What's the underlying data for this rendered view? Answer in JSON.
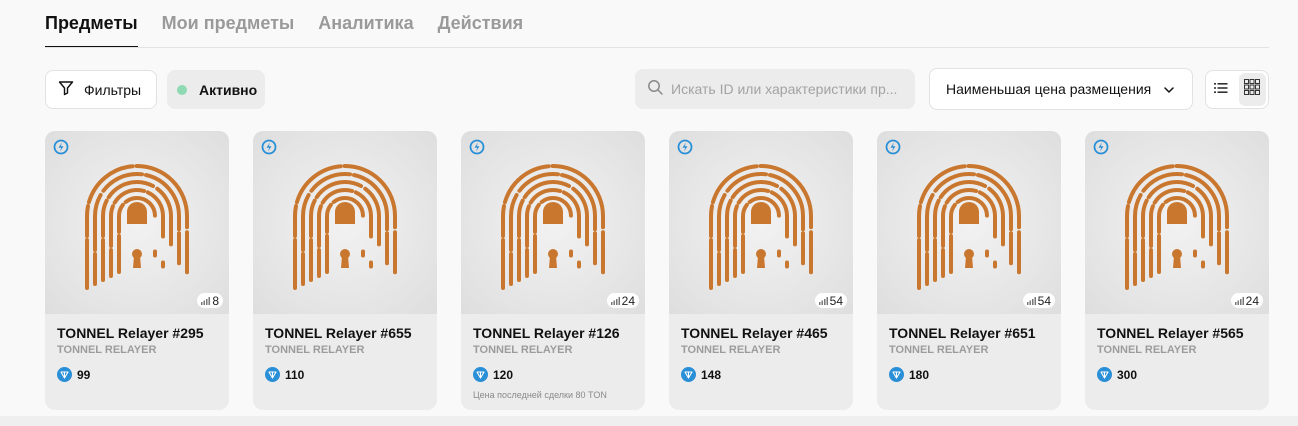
{
  "tabs": [
    {
      "label": "Предметы",
      "active": true
    },
    {
      "label": "Мои предметы",
      "active": false
    },
    {
      "label": "Аналитика",
      "active": false
    },
    {
      "label": "Действия",
      "active": false
    }
  ],
  "toolbar": {
    "filters_label": "Фильтры",
    "active_label": "Активно",
    "search_placeholder": "Искать ID или характеристики пр...",
    "sort_label": "Наименьшая цена размещения"
  },
  "colors": {
    "accent_dot": "#8fd9b3",
    "ton_blue": "#2a8fd6",
    "artwork": "#c9772f"
  },
  "cards": [
    {
      "name": "TONNEL Relayer #295",
      "collection": "TONNEL RELAYER",
      "price": "99",
      "count": "8",
      "last_sale": ""
    },
    {
      "name": "TONNEL Relayer #655",
      "collection": "TONNEL RELAYER",
      "price": "110",
      "count": "",
      "last_sale": ""
    },
    {
      "name": "TONNEL Relayer #126",
      "collection": "TONNEL RELAYER",
      "price": "120",
      "count": "24",
      "last_sale": "Цена последней сделки 80 TON"
    },
    {
      "name": "TONNEL Relayer #465",
      "collection": "TONNEL RELAYER",
      "price": "148",
      "count": "54",
      "last_sale": ""
    },
    {
      "name": "TONNEL Relayer #651",
      "collection": "TONNEL RELAYER",
      "price": "180",
      "count": "54",
      "last_sale": ""
    },
    {
      "name": "TONNEL Relayer #565",
      "collection": "TONNEL RELAYER",
      "price": "300",
      "count": "24",
      "last_sale": ""
    }
  ]
}
